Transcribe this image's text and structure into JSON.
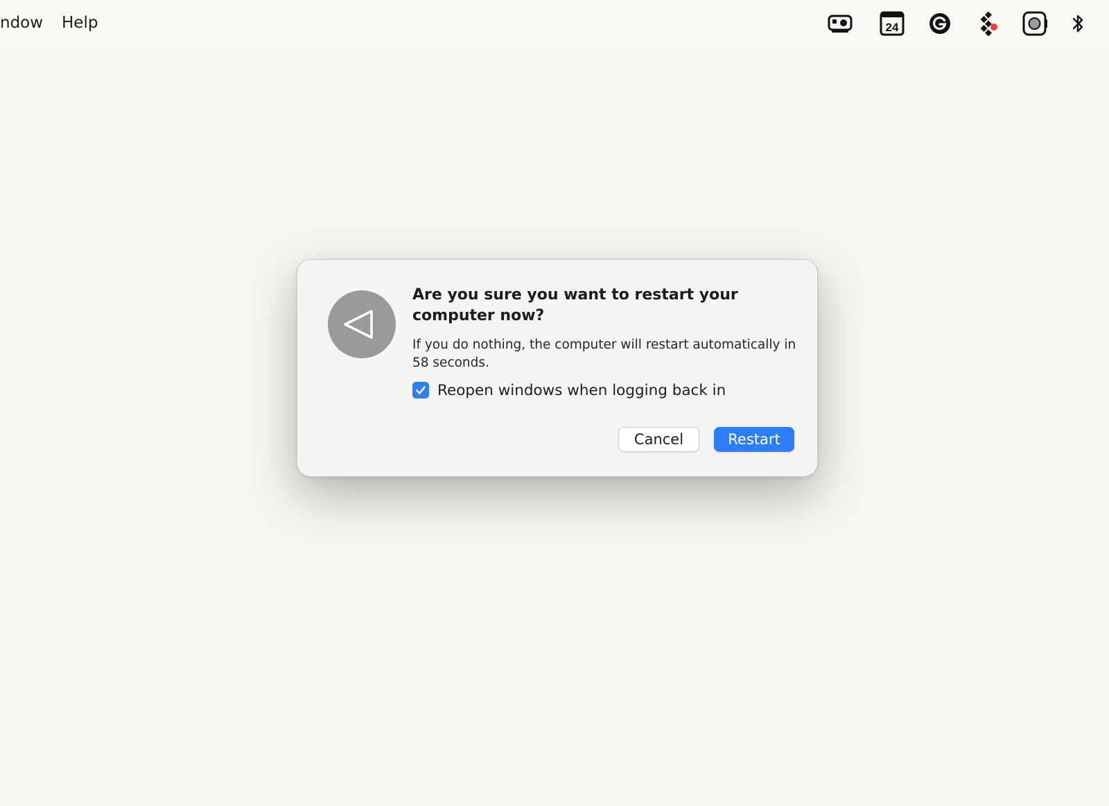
{
  "menubar": {
    "items": [
      {
        "label": "ndow"
      },
      {
        "label": "Help"
      }
    ],
    "status_icons": [
      {
        "icon": "display-icon"
      },
      {
        "icon": "calendar-24-icon",
        "text": "24"
      },
      {
        "icon": "grammarly-icon"
      },
      {
        "icon": "figma-icon"
      },
      {
        "icon": "screenshot-icon"
      },
      {
        "icon": "bluetooth-icon"
      }
    ]
  },
  "dialog": {
    "icon": "restart-arrow-icon",
    "title": "Are you sure you want to restart your computer now?",
    "message": "If you do nothing, the computer will restart automatically in 58 seconds.",
    "checkbox": {
      "label": "Reopen windows when logging back in",
      "checked": true
    },
    "buttons": {
      "cancel": "Cancel",
      "restart": "Restart"
    }
  },
  "colors": {
    "accent": "#2f7df6",
    "background": "#f8f6f2",
    "dialog_bg": "#f5f5f4",
    "icon_gray": "#9a9a9a"
  }
}
